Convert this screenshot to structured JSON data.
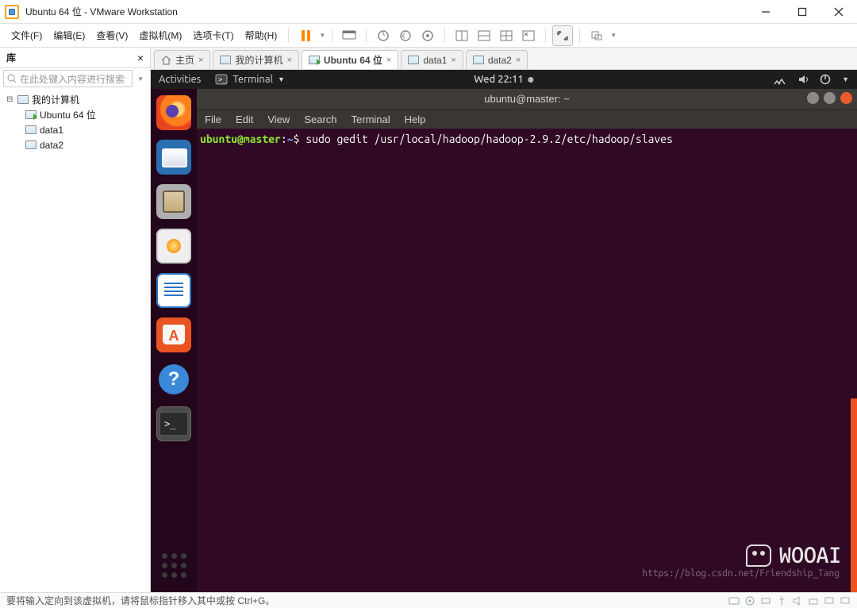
{
  "window": {
    "title": "Ubuntu 64 位 - VMware Workstation"
  },
  "menus": {
    "file": "文件(F)",
    "edit": "编辑(E)",
    "view": "查看(V)",
    "vm": "虚拟机(M)",
    "tabs": "选项卡(T)",
    "help": "帮助(H)"
  },
  "library": {
    "title": "库",
    "search_placeholder": "在此处键入内容进行搜索",
    "root": "我的计算机",
    "items": [
      "Ubuntu 64 位",
      "data1",
      "data2"
    ]
  },
  "tabs": [
    {
      "label": "主页",
      "kind": "home"
    },
    {
      "label": "我的计算机",
      "kind": "vm"
    },
    {
      "label": "Ubuntu 64 位",
      "kind": "vm",
      "active": true
    },
    {
      "label": "data1",
      "kind": "vm"
    },
    {
      "label": "data2",
      "kind": "vm"
    }
  ],
  "ubuntu": {
    "activities": "Activities",
    "app": "Terminal",
    "clock": "Wed 22:11",
    "term_title": "ubuntu@master: ~",
    "term_menu": [
      "File",
      "Edit",
      "View",
      "Search",
      "Terminal",
      "Help"
    ],
    "prompt_user": "ubuntu@master",
    "prompt_path": "~",
    "prompt_sep": ":",
    "prompt_char": "$",
    "command": "sudo gedit /usr/local/hadoop/hadoop-2.9.2/etc/hadoop/slaves"
  },
  "statusbar": {
    "text": "要将输入定向到该虚拟机，请将鼠标指针移入其中或按 Ctrl+G。"
  },
  "watermark": {
    "brand": "WOOAI",
    "sub": "https://blog.csdn.net/Friendship_Tang"
  }
}
